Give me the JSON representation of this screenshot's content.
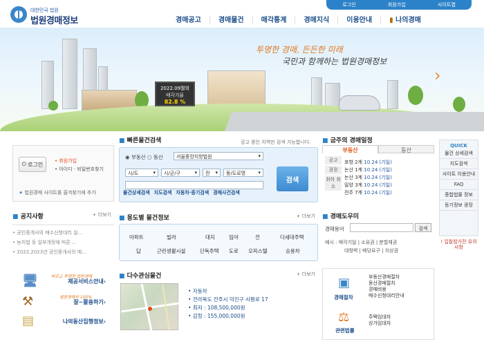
{
  "logo": {
    "subtitle": "대한민국 법원",
    "title": "법원경매정보"
  },
  "top_menu": [
    "로그인",
    "회원가입",
    "사이트맵"
  ],
  "gnb": [
    "경매공고",
    "경매물건",
    "매각통계",
    "경매지식",
    "이용안내",
    "나의경매"
  ],
  "banner": {
    "slogan1": "투명한 경매, 든든한 미래",
    "slogan2": "국민과 함께하는 법원경매정보",
    "price_line1": "2022.09월의",
    "price_line2": "매각가율",
    "price_value": "82.8 %"
  },
  "login": {
    "button": "로그인",
    "join": "회원가입",
    "find": "아이디 · 비밀번호찾기",
    "favorite": "법원경매 사이트를 즐겨찾기에 추가"
  },
  "quick_search": {
    "title": "빠른물건검색",
    "hint": "공고 중인 지역만 검색 가능합니다.",
    "radio_realty": "부동산",
    "radio_movable": "동산",
    "court_select": "서울중앙지방법원",
    "sido": "시/도",
    "sigungu": "시/군/구",
    "select_all": "전",
    "road": "동/도로명",
    "search_button": "검색",
    "links": [
      "물건상세검색",
      "지도검색",
      "자동차·중기검색",
      "경매사건검색"
    ]
  },
  "schedule": {
    "title": "금주의 경매일정",
    "tab_realty": "부동산",
    "tab_movable": "동산",
    "side": [
      "공고",
      "경정",
      "취하 취소"
    ],
    "rows": [
      {
        "court": "포항 2계",
        "date": "10.24 (기일)"
      },
      {
        "court": "논산 1계",
        "date": "10.24 (기일)"
      },
      {
        "court": "논산 3계",
        "date": "10.24 (기일)"
      },
      {
        "court": "밀양 3계",
        "date": "10.24 (기일)"
      },
      {
        "court": "전주 7계",
        "date": "10.24 (기일)"
      }
    ]
  },
  "quick_menu": {
    "header": "QUICK",
    "items": [
      "물건 상세검색",
      "지도검색",
      "사이트 이용안내",
      "FAQ",
      "종합법률 정보",
      "등기정보 광장"
    ],
    "warning": "입찰참가전 유의사항"
  },
  "notice": {
    "title": "공지사항",
    "more": "더보기",
    "items": [
      "공인중개사의 매수신청대리 실...",
      "농지법 등 일부개정에 따른 ...",
      "2022,2023년 공인중개사의 매..."
    ]
  },
  "usage": {
    "title": "용도별 물건정보",
    "more": "더보기",
    "row1": [
      "아파트",
      "빌라",
      "대지",
      "임야",
      "전",
      "다세대주택"
    ],
    "row2": [
      "답",
      "근린생활시설",
      "단독주택",
      "도로",
      "오피스텔",
      "승용차"
    ]
  },
  "dictionary": {
    "title": "경매도우미",
    "label": "경매용어",
    "button": "검색",
    "example_label": "예시 :",
    "examples": [
      "매각기일",
      "소유권",
      "분할채권",
      "대항력",
      "배당요구",
      "지상권"
    ]
  },
  "left_links": [
    {
      "small": "바르고 투명한 법원경매",
      "label": "제공서비스안내"
    },
    {
      "small": "법원경매의 100%",
      "label": "잘~활용하기"
    },
    {
      "small": "",
      "label": "나의동산집행정보"
    }
  ],
  "multi": {
    "title": "다수관심물건",
    "more": "더보기",
    "items": [
      "자동차",
      "전라북도 전주시 덕진구 사평로 17",
      "최저 : 108,500,000원",
      "감정 : 155,000,000원"
    ]
  },
  "procedure": {
    "title1": "경매절차",
    "items1": [
      "부동산경매절차",
      "동산경매절차",
      "경매비용",
      "매수신청대리안내"
    ],
    "title2": "관련법률",
    "items2": [
      "주택임대차",
      "상가임대차"
    ]
  }
}
